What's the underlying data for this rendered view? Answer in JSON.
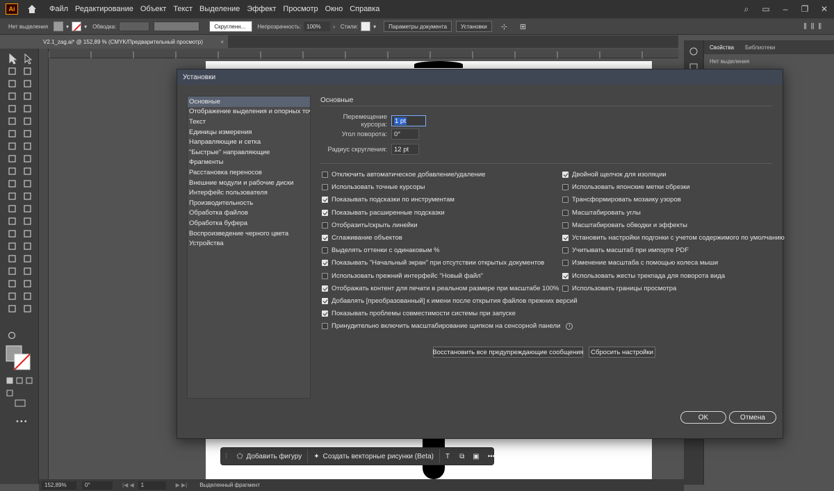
{
  "menubar": {
    "items": [
      "Файл",
      "Редактирование",
      "Объект",
      "Текст",
      "Выделение",
      "Эффект",
      "Просмотр",
      "Окно",
      "Справка"
    ]
  },
  "controlbar": {
    "selection_status": "Нет выделения",
    "stroke_label": "Обводка:",
    "profile_label": "Скругленн...",
    "opacity_label": "Непрозрачность:",
    "opacity_value": "100%",
    "styles_label": "Стили:",
    "doc_settings_button": "Параметры документа",
    "prefs_button": "Установки"
  },
  "document_tab": {
    "title": "V2.1_zag.ai* @ 152,89 % (CMYK/Предварительный просмотр)",
    "close": "×"
  },
  "right_panel": {
    "tabs": [
      "Свойства",
      "Библиотеки"
    ],
    "subtitle": "Нет выделения"
  },
  "statusbar": {
    "zoom": "152,89%",
    "rotation": "0°",
    "artboard": "1",
    "status_text": "Выделенный фрагмент"
  },
  "context_bar": {
    "add_shape": "Добавить фигуру",
    "create_vectors": "Создать векторные рисунки (Beta)"
  },
  "dialog": {
    "title": "Установки",
    "nav": [
      "Основные",
      "Отображение выделения и опорных точек",
      "Текст",
      "Единицы измерения",
      "Направляющие и сетка",
      "\"Быстрые\" направляющие",
      "Фрагменты",
      "Расстановка переносов",
      "Внешние модули и рабочие диски",
      "Интерфейс пользователя",
      "Производительность",
      "Обработка файлов",
      "Обработка буфера",
      "Воспроизведение черного цвета",
      "Устройства"
    ],
    "section_title": "Основные",
    "fields": {
      "cursor_move_label": "Перемещение курсора:",
      "cursor_move_value": "1 pt",
      "rotation_label": "Угол поворота:",
      "rotation_value": "0°",
      "radius_label": "Радиус скругления:",
      "radius_value": "12 pt"
    },
    "checkboxes_left": [
      {
        "label": "Отключить автоматическое добавление/удаление",
        "checked": false
      },
      {
        "label": "Использовать точные курсоры",
        "checked": false
      },
      {
        "label": "Показывать подсказки по инструментам",
        "checked": true
      },
      {
        "label": "Показывать расширенные подсказки",
        "checked": true
      },
      {
        "label": "Отобразить/скрыть линейки",
        "checked": false
      },
      {
        "label": "Сглаживание объектов",
        "checked": true
      },
      {
        "label": "Выделять оттенки с одинаковым %",
        "checked": false
      },
      {
        "label": "Показывать \"Начальный экран\" при отсутствии открытых документов",
        "checked": true
      },
      {
        "label": "Использовать прежний интерфейс \"Новый файл\"",
        "checked": false
      },
      {
        "label": "Отображать контент для печати в реальном размере при масштабе 100%",
        "checked": true
      },
      {
        "label": "Добавлять [преобразованный] к имени после открытия файлов прежних версий",
        "checked": true
      },
      {
        "label": "Показывать проблемы совместимости системы при запуске",
        "checked": true
      },
      {
        "label": "Принудительно включить масштабирование щипком на сенсорной панели",
        "checked": false
      }
    ],
    "checkboxes_right": [
      {
        "label": "Двойной щелчок для изоляции",
        "checked": true
      },
      {
        "label": "Использовать японские метки обрезки",
        "checked": false
      },
      {
        "label": "Трансформировать мозаику узоров",
        "checked": false
      },
      {
        "label": "Масштабировать углы",
        "checked": false
      },
      {
        "label": "Масштабировать обводки и эффекты",
        "checked": false
      },
      {
        "label": "Установить настройки подгонки с учетом содержимого по умолчанию",
        "checked": true
      },
      {
        "label": "Учитывать масштаб при импорте PDF",
        "checked": false
      },
      {
        "label": "Изменение масштаба с помощью колеса мыши",
        "checked": false
      },
      {
        "label": "Использовать жесты трекпада для поворота вида",
        "checked": true
      },
      {
        "label": "Использовать границы просмотра",
        "checked": false
      }
    ],
    "reset_warnings_button": "Восстановить все предупреждающие сообщения",
    "reset_prefs_button": "Сбросить настройки",
    "ok_button": "OK",
    "cancel_button": "Отмена"
  }
}
